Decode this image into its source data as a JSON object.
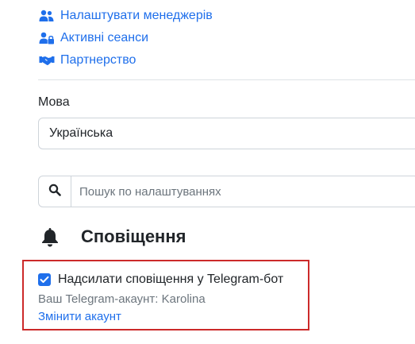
{
  "links": [
    {
      "label": "Налаштувати менеджерів",
      "icon": "users-cog-icon"
    },
    {
      "label": "Активні сеанси",
      "icon": "user-lock-icon"
    },
    {
      "label": "Партнерство",
      "icon": "handshake-icon"
    }
  ],
  "language": {
    "label": "Мова",
    "selected": "Українська"
  },
  "search": {
    "placeholder": "Пошук по налаштуваннях"
  },
  "notifications": {
    "title": "Сповіщення",
    "telegram_checkbox_label": "Надсилати сповіщення у Telegram-бот",
    "telegram_checked": true,
    "account_text": "Ваш Telegram-акаунт: Karolina",
    "change_account_label": "Змінити акаунт"
  },
  "colors": {
    "link": "#1f6feb",
    "highlight_border": "#cc2a2a",
    "muted_text": "#6c757d"
  }
}
